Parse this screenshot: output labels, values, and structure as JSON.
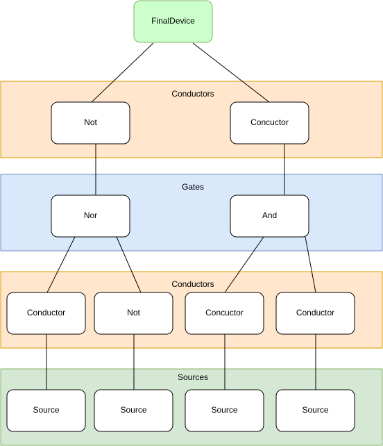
{
  "root": {
    "label": "FinalDevice",
    "fill": "#ccffcc",
    "stroke": "#82b366"
  },
  "groups": [
    {
      "label": "Conductors",
      "fill": "#ffe6cc",
      "stroke": "#d79b00"
    },
    {
      "label": "Gates",
      "fill": "#dae8fc",
      "stroke": "#6c8ebf"
    },
    {
      "label": "Conductors",
      "fill": "#ffe6cc",
      "stroke": "#d79b00"
    },
    {
      "label": "Sources",
      "fill": "#d5e8d4",
      "stroke": "#82b366"
    }
  ],
  "nodes": {
    "level1": [
      "Not",
      "Concuctor"
    ],
    "gates": [
      "Nor",
      "And"
    ],
    "level3": [
      "Conductor",
      "Not",
      "Concuctor",
      "Conductor"
    ],
    "sources": [
      "Source",
      "Source",
      "Source",
      "Source"
    ]
  }
}
